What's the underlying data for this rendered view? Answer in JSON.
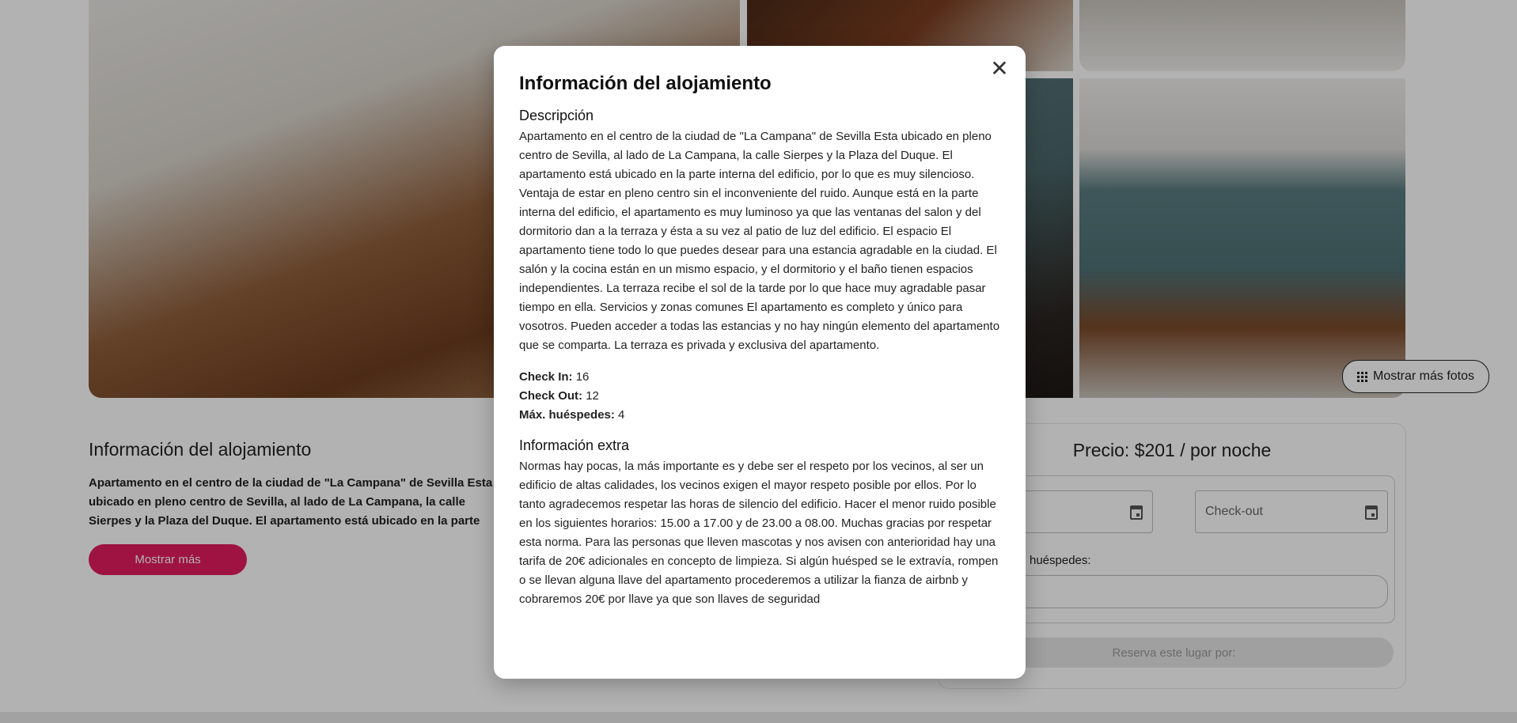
{
  "gallery": {
    "show_more_photos": "Mostrar más fotos"
  },
  "listing": {
    "title": "Información del alojamiento",
    "excerpt": "Apartamento en el centro de la ciudad de \"La Campana\" de Sevilla Esta ubicado en pleno centro de Sevilla, al lado de La Campana, la calle Sierpes y la Plaza del Duque. El apartamento está ubicado en la parte interna del edificio, por lo que es muy silencioso. Ventaja de estar en pleno centro sin el inconveniente del ruido. Aunque está en la parte interna del edificio",
    "show_more": "Mostrar más"
  },
  "booking": {
    "price": "Precio: $201 / por noche",
    "checkin_placeholder": "",
    "checkout_placeholder": "Check-out",
    "guests_label": "huéspedes:",
    "reserve": "Reserva este lugar por:"
  },
  "modal": {
    "title": "Información del alojamiento",
    "close_symbol": "✕",
    "description_title": "Descripción",
    "description": "Apartamento en el centro de la ciudad de \"La Campana\" de Sevilla Esta ubicado en pleno centro de Sevilla, al lado de La Campana, la calle Sierpes y la Plaza del Duque. El apartamento está ubicado en la parte interna del edificio, por lo que es muy silencioso. Ventaja de estar en pleno centro sin el inconveniente del ruido. Aunque está en la parte interna del edificio, el apartamento es muy luminoso ya que las ventanas del salon y del dormitorio dan a la terraza y ésta a su vez al patio de luz del edificio. El espacio El apartamento tiene todo lo que puedes desear para una estancia agradable en la ciudad. El salón y la cocina están en un mismo espacio, y el dormitorio y el baño tienen espacios independientes. La terraza recibe el sol de la tarde por lo que hace muy agradable pasar tiempo en ella. Servicios y zonas comunes El apartamento es completo y único para vosotros. Pueden acceder a todas las estancias y no hay ningún elemento del apartamento que se comparta. La terraza es privada y exclusiva del apartamento.",
    "checkin_label": "Check In:",
    "checkin_value": "16",
    "checkout_label": "Check Out:",
    "checkout_value": "12",
    "max_guests_label": "Máx. huéspedes:",
    "max_guests_value": "4",
    "extra_title": "Información extra",
    "extra": "Normas hay pocas, la más importante es y debe ser el respeto por los vecinos, al ser un edificio de altas calidades, los vecinos exigen el mayor respeto posible por ellos. Por lo tanto agradecemos respetar las horas de silencio del edificio. Hacer el menor ruido posible en los siguientes horarios: 15.00 a 17.00 y de 23.00 a 08.00. Muchas gracias por respetar esta norma. Para las personas que lleven mascotas y nos avisen con anterioridad hay una tarifa de 20€ adicionales en concepto de limpieza. Si algún huésped se le extravía, rompen o se llevan alguna llave del apartamento procederemos a utilizar la fianza de airbnb y cobraremos 20€ por llave ya que son llaves de seguridad"
  }
}
